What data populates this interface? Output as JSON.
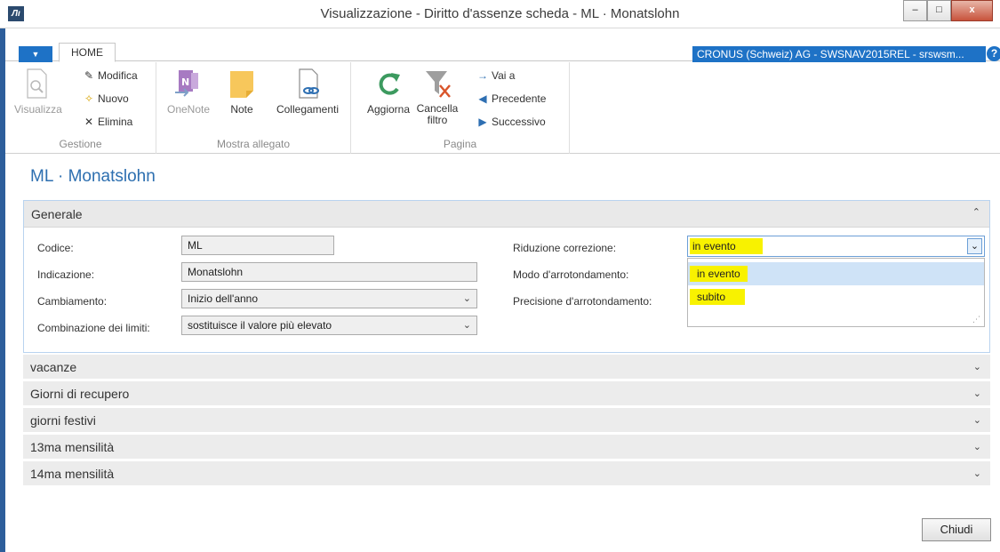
{
  "window": {
    "title": "Visualizzazione - Diritto d'assenze scheda - ML · Monatslohn",
    "logo_text": "Лı",
    "minimize": "–",
    "maximize": "□",
    "close": "x"
  },
  "ribbon_tabs": {
    "app_menu": "▼",
    "home": "HOME"
  },
  "company": "CRONUS (Schweiz) AG - SWSNAV2015REL - srswsm...",
  "help": "?",
  "ribbon": {
    "gestione": {
      "label": "Gestione",
      "visualizza": "Visualizza",
      "modifica": "Modifica",
      "nuovo": "Nuovo",
      "elimina": "Elimina"
    },
    "mostra_allegato": {
      "label": "Mostra allegato",
      "onenote": "OneNote",
      "note": "Note",
      "collegamenti": "Collegamenti"
    },
    "pagina": {
      "label": "Pagina",
      "aggiorna": "Aggiorna",
      "cancella_filtro_1": "Cancella",
      "cancella_filtro_2": "filtro",
      "vai_a": "Vai a",
      "precedente": "Precedente",
      "successivo": "Successivo"
    }
  },
  "page_title": "ML · Monatslohn",
  "generale": {
    "title": "Generale",
    "codice_label": "Codice:",
    "codice_value": "ML",
    "indicazione_label": "Indicazione:",
    "indicazione_value": "Monatslohn",
    "cambiamento_label": "Cambiamento:",
    "cambiamento_value": "Inizio dell'anno",
    "combinazione_label": "Combinazione dei limiti:",
    "combinazione_value": "sostituisce il valore più elevato",
    "riduzione_label": "Riduzione correzione:",
    "riduzione_value": "in evento",
    "modo_label": "Modo d'arrotondamento:",
    "precisione_label": "Precisione d'arrotondamento:",
    "dropdown_options": [
      "in evento",
      "subito"
    ]
  },
  "sections": [
    "vacanze",
    "Giorni di recupero",
    "giorni festivi",
    "13ma mensilità",
    "14ma mensilità"
  ],
  "close_button": "Chiudi",
  "colors": {
    "accent": "#1e72c6",
    "highlight": "#f8f200",
    "title": "#2d6fb0"
  }
}
